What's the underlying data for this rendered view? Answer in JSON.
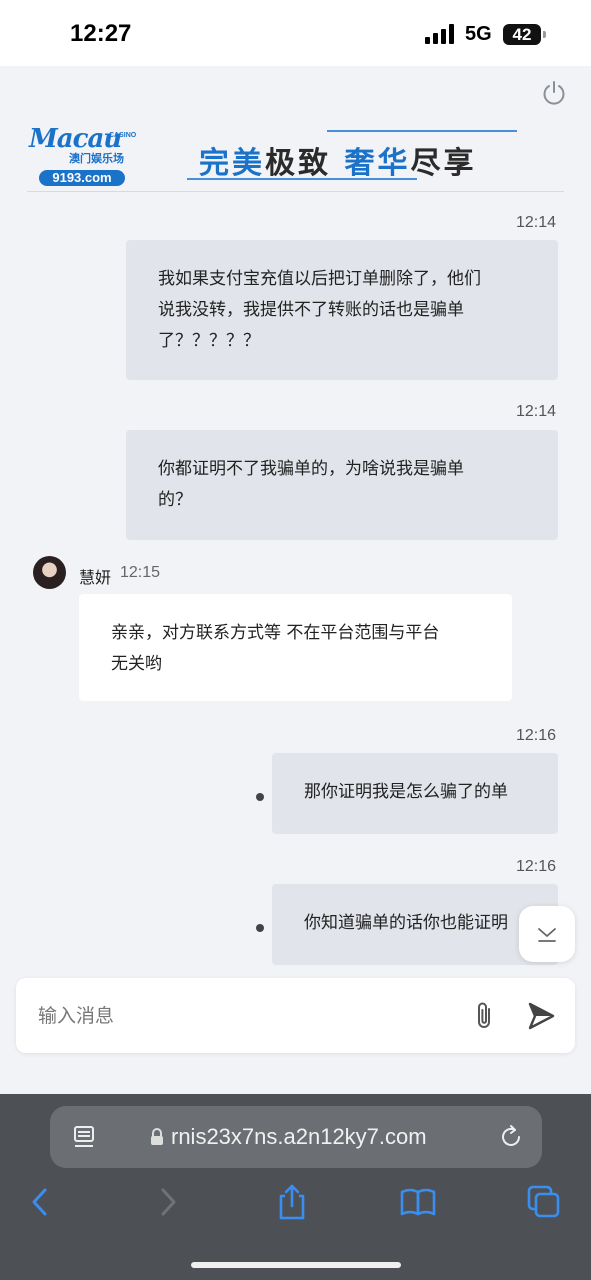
{
  "status_bar": {
    "time": "12:27",
    "network": "5G",
    "battery": "42",
    "battery_level": 0.42
  },
  "banner": {
    "logo_word": "Macau",
    "logo_casino": "CASINO",
    "logo_cn": "澳门娱乐场",
    "logo_domain": "9193.com",
    "slogan_part1": "完美",
    "slogan_part2": "极致",
    "slogan_part3": "奢华",
    "slogan_part4": "尽享"
  },
  "messages": [
    {
      "time": "12:14",
      "lines": [
        "我如果支付宝充值以后把订单删除了，他们",
        "说我没转，我提供不了转账的话也是骗单",
        "了？？？？？"
      ]
    },
    {
      "time": "12:14",
      "lines": [
        "你都证明不了我骗单的，为啥说我是骗单",
        "的？"
      ]
    },
    {
      "sender": "慧妍",
      "time": "12:15",
      "lines": [
        "亲亲，对方联系方式等 不在平台范围与平台",
        "无关哟"
      ]
    },
    {
      "time": "12:16",
      "lines": [
        "那你证明我是怎么骗了的单"
      ]
    },
    {
      "time": "12:16",
      "lines": [
        "你知道骗单的话你也能证明"
      ]
    }
  ],
  "composer": {
    "placeholder": "输入消息"
  },
  "browser": {
    "url": "rnis23x7ns.a2n12ky7.com"
  },
  "colors": {
    "accent": "#1a72c9",
    "outgoing_bubble": "#e1e4ea",
    "incoming_bubble": "#ffffff",
    "browser_chrome": "#4d5155",
    "ios_blue": "#3a8ef0"
  },
  "icons": [
    "power-icon",
    "paperclip-icon",
    "send-icon",
    "chevron-down-icon",
    "reader-icon",
    "lock-icon",
    "reload-icon",
    "back-icon",
    "forward-icon",
    "share-icon",
    "bookmarks-icon",
    "tabs-icon"
  ]
}
